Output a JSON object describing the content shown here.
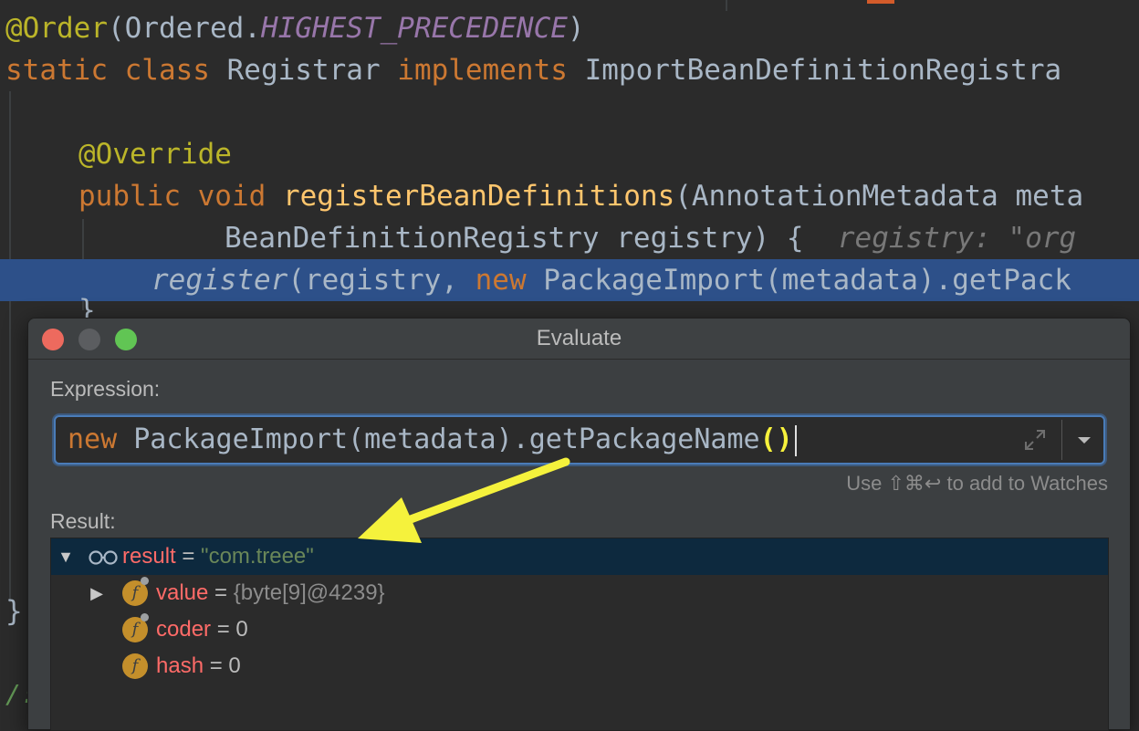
{
  "editor": {
    "line_order_annotation": "@Order",
    "line_order_paren_open": "(",
    "line_order_class": "Ordered.",
    "line_order_const": "HIGHEST_PRECEDENCE",
    "line_order_paren_close": ")",
    "line_class_kw": "static class ",
    "line_class_name": "Registrar ",
    "line_class_impl": "implements ",
    "line_class_iface": "ImportBeanDefinitionRegistra",
    "line_override": "@Override",
    "line_method_kw": "public void ",
    "line_method_name": "registerBeanDefinitions",
    "line_method_params": "(AnnotationMetadata meta",
    "line_params2": "BeanDefinitionRegistry registry) { ",
    "line_params2_hint": " registry: \"org",
    "line_current_call": "register",
    "line_current_args": "(registry, ",
    "line_current_new": "new ",
    "line_current_rest": "PackageImport(metadata).getPack",
    "closing_brace_1": "}",
    "closing_brace_2": "}",
    "comment_fragment": "/:"
  },
  "dialog": {
    "title": "Evaluate",
    "expression_label": "Expression:",
    "expression_kw": "new ",
    "expression_body": "PackageImport(metadata).getPackageName",
    "expression_parens": "()",
    "watches_hint": "Use ⇧⌘↩ to add to Watches",
    "result_label": "Result:",
    "result": {
      "name": "result",
      "eq": " = ",
      "value": "\"com.treee\"",
      "children": [
        {
          "name": "value",
          "eq": " = ",
          "value": "{byte[9]@4239}"
        },
        {
          "name": "coder",
          "eq": " = ",
          "value": "0"
        },
        {
          "name": "hash",
          "eq": " = ",
          "value": "0"
        }
      ]
    }
  },
  "colors": {
    "editor_bg": "#2b2b2b",
    "highlight_line": "#2d5089",
    "annotation": "#bbb529",
    "keyword": "#cc7832",
    "arrow": "#f5f23c"
  }
}
